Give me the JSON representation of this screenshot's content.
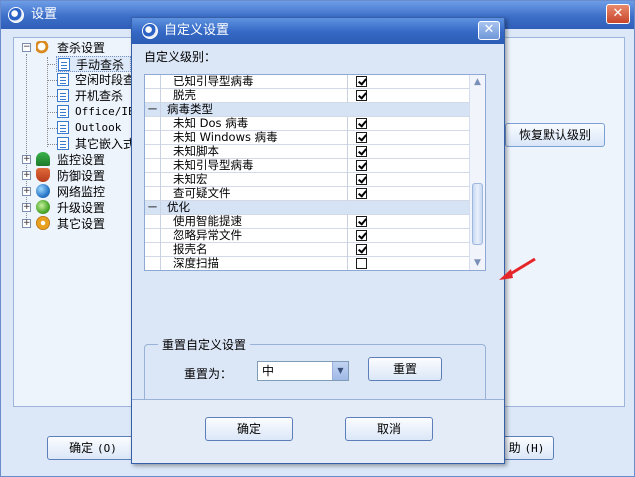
{
  "outer_window": {
    "title": "设置",
    "tree": [
      {
        "label": "查杀设置",
        "icon": "magnifier-icon",
        "expanded": true
      },
      {
        "label": "手动查杀",
        "icon": "document-icon",
        "selected": true
      },
      {
        "label": "空闲时段查",
        "icon": "document-icon"
      },
      {
        "label": "开机查杀",
        "icon": "document-icon"
      },
      {
        "label": "Office/IE",
        "icon": "document-icon"
      },
      {
        "label": "Outlook",
        "icon": "document-icon"
      },
      {
        "label": "其它嵌入式",
        "icon": "document-icon"
      },
      {
        "label": "监控设置",
        "icon": "umbrella-icon"
      },
      {
        "label": "防御设置",
        "icon": "shield-icon"
      },
      {
        "label": "网络监控",
        "icon": "globe-icon"
      },
      {
        "label": "升级设置",
        "icon": "update-icon"
      },
      {
        "label": "其它设置",
        "icon": "gear-icon"
      }
    ],
    "restore_default_label": "恢复默认级别",
    "ok_label": "确定",
    "ok_hotkey": "(O)",
    "help_label": "助",
    "help_hotkey": "(H)"
  },
  "dialog": {
    "title": "自定义设置",
    "custom_level_label": "自定义级别：",
    "rows": [
      {
        "type": "item",
        "name": "已知引导型病毒",
        "checked": true
      },
      {
        "type": "item",
        "name": "脱壳",
        "checked": true
      },
      {
        "type": "group",
        "name": "病毒类型",
        "sign": "－"
      },
      {
        "type": "item",
        "name": "未知 Dos 病毒",
        "checked": true
      },
      {
        "type": "item",
        "name": "未知 Windows 病毒",
        "checked": true
      },
      {
        "type": "item",
        "name": "未知脚本",
        "checked": true
      },
      {
        "type": "item",
        "name": "未知引导型病毒",
        "checked": true
      },
      {
        "type": "item",
        "name": "未知宏",
        "checked": true
      },
      {
        "type": "item",
        "name": "查可疑文件",
        "checked": true
      },
      {
        "type": "group",
        "name": "优化",
        "sign": "－"
      },
      {
        "type": "item",
        "name": "使用智能提速",
        "checked": true
      },
      {
        "type": "item",
        "name": "忽略异常文件",
        "checked": true
      },
      {
        "type": "item",
        "name": "报壳名",
        "checked": true
      },
      {
        "type": "item",
        "name": "深度扫描",
        "checked": false
      }
    ],
    "reset_group_label": "重置自定义设置",
    "reset_to_label": "重置为：",
    "reset_level_value": "中",
    "reset_button_label": "重置",
    "ok_label": "确定",
    "cancel_label": "取消",
    "arrow_color": "#e4262a"
  }
}
